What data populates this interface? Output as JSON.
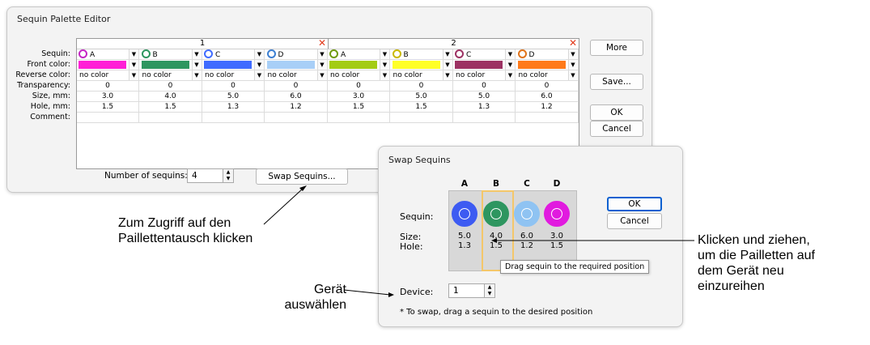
{
  "main_dialog": {
    "title": "Sequin Palette Editor",
    "groups": [
      {
        "label": "1",
        "close": "✕"
      },
      {
        "label": "2",
        "close": "✕"
      }
    ],
    "row_labels": [
      "Sequin:",
      "Front color:",
      "Reverse color:",
      "Transparency:",
      "Size, mm:",
      "Hole, mm:",
      "Comment:"
    ],
    "columns": [
      {
        "sequin": "A",
        "front": "#ff1fd6",
        "reverse": "no color",
        "transparency": "0",
        "size": "3.0",
        "hole": "1.5",
        "ring": "#c426c4"
      },
      {
        "sequin": "B",
        "front": "#2e9660",
        "reverse": "no color",
        "transparency": "0",
        "size": "4.0",
        "hole": "1.5",
        "ring": "#2e9660"
      },
      {
        "sequin": "C",
        "front": "#3f6bff",
        "reverse": "no color",
        "transparency": "0",
        "size": "5.0",
        "hole": "1.3",
        "ring": "#3f6bff"
      },
      {
        "sequin": "D",
        "front": "#a8cff7",
        "reverse": "no color",
        "transparency": "0",
        "size": "6.0",
        "hole": "1.2",
        "ring": "#3d7fd1"
      },
      {
        "sequin": "A",
        "front": "#a3cc14",
        "reverse": "no color",
        "transparency": "0",
        "size": "3.0",
        "hole": "1.5",
        "ring": "#6f9a10"
      },
      {
        "sequin": "B",
        "front": "#ffff28",
        "reverse": "no color",
        "transparency": "0",
        "size": "5.0",
        "hole": "1.5",
        "ring": "#c9b800"
      },
      {
        "sequin": "C",
        "front": "#9c3263",
        "reverse": "no color",
        "transparency": "0",
        "size": "5.0",
        "hole": "1.3",
        "ring": "#9c3263"
      },
      {
        "sequin": "D",
        "front": "#ff7a1a",
        "reverse": "no color",
        "transparency": "0",
        "size": "6.0",
        "hole": "1.2",
        "ring": "#e0731a"
      }
    ],
    "buttons": {
      "more": "More",
      "save": "Save...",
      "ok": "OK",
      "cancel": "Cancel",
      "swap": "Swap Sequins..."
    },
    "num_sequins_label": "Number of sequins:",
    "num_sequins_value": "4"
  },
  "swap_dialog": {
    "title": "Swap Sequins",
    "columns": [
      {
        "letter": "A",
        "color": "#3d5bf2",
        "size": "5.0",
        "hole": "1.3"
      },
      {
        "letter": "B",
        "color": "#2e9660",
        "size": "4.0",
        "hole": "1.5"
      },
      {
        "letter": "C",
        "color": "#8fc3f2",
        "size": "6.0",
        "hole": "1.2"
      },
      {
        "letter": "D",
        "color": "#e11adf",
        "size": "3.0",
        "hole": "1.5"
      }
    ],
    "sequin_label": "Sequin:",
    "size_label": "Size:",
    "hole_label": "Hole:",
    "tooltip": "Drag sequin to the required position",
    "device_label": "Device:",
    "device_value": "1",
    "note": "* To swap, drag a sequin to the desired position",
    "ok": "OK",
    "cancel": "Cancel"
  },
  "annotations": {
    "swap_access": "Zum Zugriff auf den\nPaillettentausch klicken",
    "click_drag": "Klicken und ziehen,\num die Pailletten auf\ndem Gerät neu\neinzureihen",
    "select_device": "Gerät\nauswählen"
  }
}
